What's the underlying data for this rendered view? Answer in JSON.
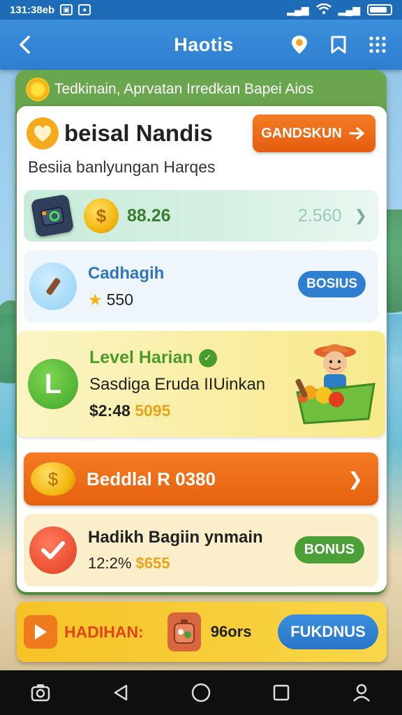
{
  "status_bar": {
    "time": "131:38eb",
    "signal": "..ıl",
    "wifi": "wifi",
    "battery_level": 0.85
  },
  "app_bar": {
    "title": "Haotis"
  },
  "banner": {
    "text": "Tedkinain,  Aprvatan Irredkan Bapei Aios"
  },
  "user": {
    "name": "beisal Nandis",
    "subtitle": "Besiia banlyungan Harqes",
    "action_label": "GANDSKUN"
  },
  "wallet": {
    "balance": "88.26",
    "secondary": "2.560"
  },
  "cash": {
    "title": "Cadhagih",
    "amount": "550",
    "bonus_label": "BOSIUS"
  },
  "level": {
    "title": "Level Harian",
    "subtitle": "Sasdiga Eruda IIUinkan",
    "price_a": "$2:48",
    "price_b": "5095"
  },
  "reward": {
    "label": "Beddlal R 0380"
  },
  "daily": {
    "title": "Hadikh Bagiin ynmain",
    "sub_a": "12:2%",
    "sub_b": "$655",
    "bonus_label": "BONUS"
  },
  "bottom": {
    "label": "HADIHAN:",
    "count": "96ors",
    "button_label": "FUKDNUS"
  },
  "colors": {
    "primary_blue": "#2f7fd0",
    "orange": "#f47b23",
    "green": "#4aa036",
    "yellow": "#f6c325"
  }
}
